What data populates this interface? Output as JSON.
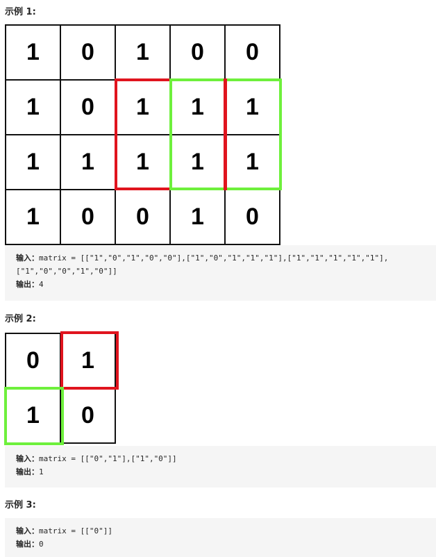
{
  "example1": {
    "title": "示例 1:",
    "grid": [
      [
        "1",
        "0",
        "1",
        "0",
        "0"
      ],
      [
        "1",
        "0",
        "1",
        "1",
        "1"
      ],
      [
        "1",
        "1",
        "1",
        "1",
        "1"
      ],
      [
        "1",
        "0",
        "0",
        "1",
        "0"
      ]
    ],
    "input_label": "输入：",
    "input_value_line1": "matrix = [[\"1\",\"0\",\"1\",\"0\",\"0\"],[\"1\",\"0\",\"1\",\"1\",\"1\"],[\"1\",\"1\",\"1\",\"1\",\"1\"],",
    "input_value_line2": "[\"1\",\"0\",\"0\",\"1\",\"0\"]]",
    "output_label": "输出：",
    "output_value": "4"
  },
  "example2": {
    "title": "示例 2:",
    "grid": [
      [
        "0",
        "1"
      ],
      [
        "1",
        "0"
      ]
    ],
    "input_label": "输入：",
    "input_value": "matrix = [[\"0\",\"1\"],[\"1\",\"0\"]]",
    "output_label": "输出：",
    "output_value": "1"
  },
  "example3": {
    "title": "示例 3:",
    "input_label": "输入：",
    "input_value": "matrix = [[\"0\"]]",
    "output_label": "输出：",
    "output_value": "0"
  },
  "colors": {
    "highlight_red": "#e0141e",
    "highlight_green": "#6ef03c",
    "code_bg": "#f5f5f5"
  }
}
